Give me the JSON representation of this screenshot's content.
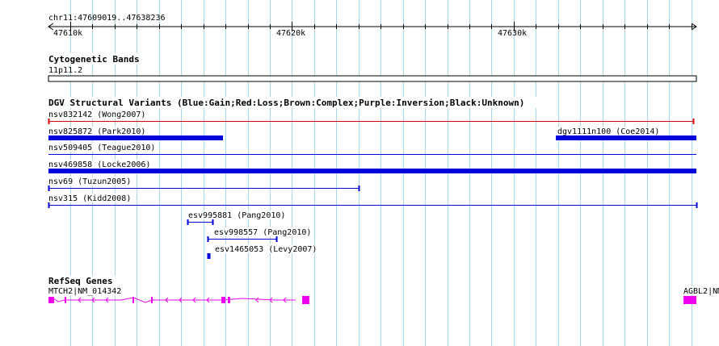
{
  "ruler": {
    "position_label": "chr11:47609019..47638236",
    "ticks": [
      "47610k",
      "47620k",
      "47630k"
    ]
  },
  "cytoband": {
    "title": "Cytogenetic Bands",
    "band": "11p11.2"
  },
  "dgv": {
    "title": "DGV Structural Variants (Blue:Gain;Red:Loss;Brown:Complex;Purple:Inversion;Black:Unknown)",
    "features": [
      {
        "label": "nsv832142 (Wong2007)",
        "type": "loss",
        "style": "capped",
        "start": 47609019,
        "end": 47638100
      },
      {
        "label": "nsv825872 (Park2010)",
        "type": "gain",
        "style": "bar",
        "start": 47609019,
        "end": 47616900
      },
      {
        "label": "dgv1111n100 (Coe2014)",
        "type": "gain",
        "style": "bar",
        "start": 47631900,
        "end": 47638236
      },
      {
        "label": "nsv509405 (Teague2010)",
        "type": "gain",
        "style": "line",
        "start": 47609019,
        "end": 47638236
      },
      {
        "label": "nsv469858 (Locke2006)",
        "type": "gain",
        "style": "bar",
        "start": 47609019,
        "end": 47638236
      },
      {
        "label": "nsv69 (Tuzun2005)",
        "type": "gain",
        "style": "capped",
        "start": 47609019,
        "end": 47623000
      },
      {
        "label": "nsv315 (Kidd2008)",
        "type": "gain",
        "style": "capped",
        "start": 47609019,
        "end": 47638236
      },
      {
        "label": "esv995881 (Pang2010)",
        "type": "gain",
        "style": "capped",
        "start": 47615300,
        "end": 47616400
      },
      {
        "label": "esv998557 (Pang2010)",
        "type": "gain",
        "style": "capped",
        "start": 47616200,
        "end": 47619300
      },
      {
        "label": "esv1465053 (Levy2007)",
        "type": "gain",
        "style": "capped",
        "start": 47616200,
        "end": 47616260
      }
    ]
  },
  "refseq": {
    "title": "RefSeq Genes",
    "genes": [
      {
        "label": "MTCH2|NM_014342",
        "start": 47609019,
        "end": 47620150
      },
      {
        "label": "AGBL2|NM",
        "start": 47637750,
        "end": 47638236
      }
    ]
  },
  "colors": {
    "gain": "#0000dd",
    "loss": "#dd0000",
    "gene": "#ee00ee",
    "grid": "#a8d8ee"
  }
}
